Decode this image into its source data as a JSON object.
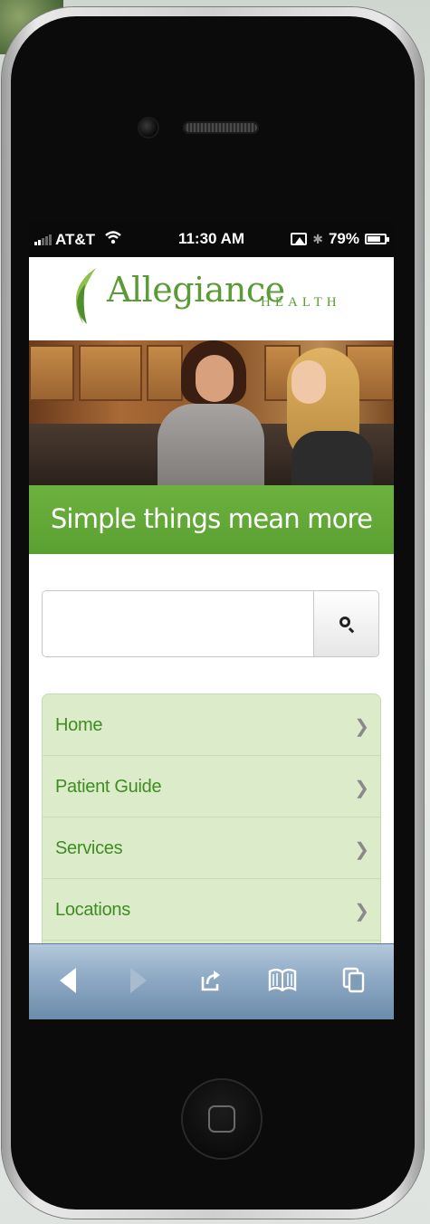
{
  "status_bar": {
    "carrier": "AT&T",
    "time": "11:30 AM",
    "battery_percent": "79%",
    "battery_level": 0.79,
    "icons": [
      "signal-icon",
      "wifi-icon",
      "airplay-icon",
      "bluetooth-icon",
      "battery-icon"
    ]
  },
  "header": {
    "logo_name": "Allegiance",
    "logo_subtitle": "HEALTH"
  },
  "banner": {
    "tagline": "Simple things mean more"
  },
  "search": {
    "value": "",
    "placeholder": "",
    "button_icon": "search-icon"
  },
  "menu": {
    "items": [
      {
        "label": "Home"
      },
      {
        "label": "Patient Guide"
      },
      {
        "label": "Services"
      },
      {
        "label": "Locations"
      }
    ]
  },
  "toolbar": {
    "icons": [
      "back-icon",
      "forward-icon",
      "share-icon",
      "bookmarks-icon",
      "pages-icon"
    ]
  },
  "colors": {
    "brand_green": "#5a9b35",
    "menu_bg": "#dcebc9",
    "menu_text": "#3f8d22",
    "toolbar_blue": "#8ea9c4"
  }
}
